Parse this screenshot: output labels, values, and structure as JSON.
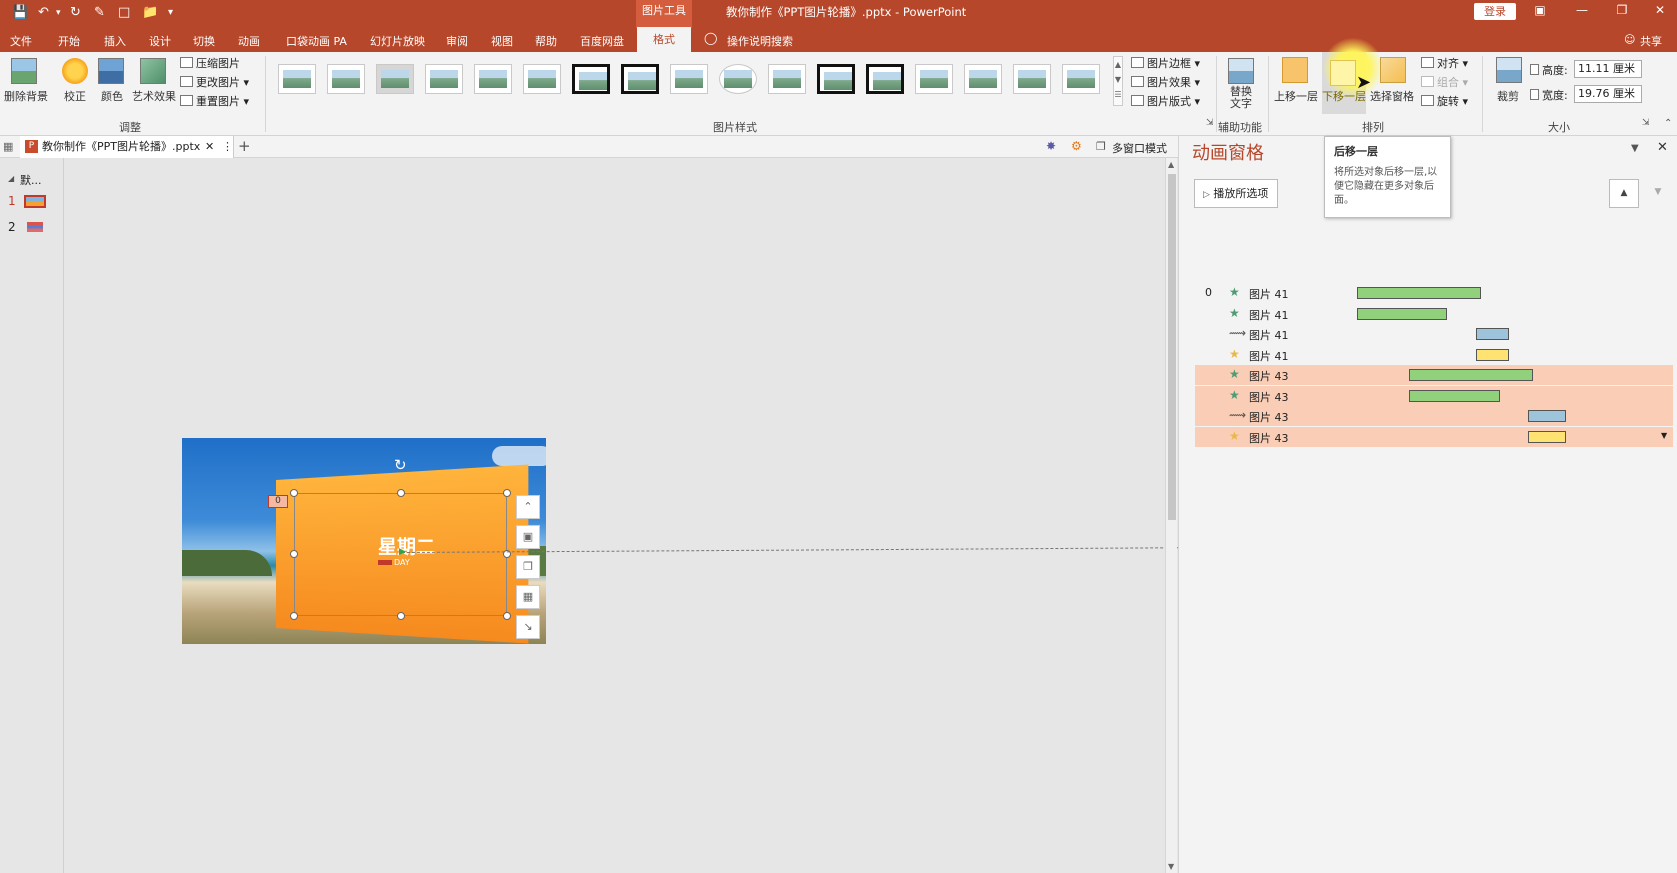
{
  "window": {
    "title": "教你制作《PPT图片轮播》.pptx  -  PowerPoint",
    "context_tab_group": "图片工具",
    "login": "登录",
    "share": "共享"
  },
  "menu_tabs": [
    "文件",
    "开始",
    "插入",
    "设计",
    "切换",
    "动画",
    "口袋动画 PA",
    "幻灯片放映",
    "审阅",
    "视图",
    "帮助",
    "百度网盘"
  ],
  "active_tab": "格式",
  "tell_me": "操作说明搜索",
  "ribbon": {
    "adjust": {
      "remove_bg": "删除背景",
      "correct": "校正",
      "color": "颜色",
      "art_effects": "艺术效果",
      "compress": "压缩图片",
      "change": "更改图片",
      "reset": "重置图片",
      "group_label": "调整"
    },
    "styles": {
      "group_label": "图片样式",
      "border": "图片边框",
      "effects": "图片效果",
      "layout": "图片版式"
    },
    "accessibility": {
      "alt_text": "替换\n文字",
      "group_label": "辅助功能"
    },
    "arrange": {
      "bring_forward": "上移一层",
      "send_backward": "下移一层",
      "selection_pane": "选择窗格",
      "align": "对齐",
      "group": "组合",
      "rotate": "旋转",
      "group_label": "排列"
    },
    "size": {
      "crop": "裁剪",
      "height_label": "高度:",
      "height_value": "11.11 厘米",
      "width_label": "宽度:",
      "width_value": "19.76 厘米",
      "group_label": "大小"
    }
  },
  "doc_tab": {
    "name": "教你制作《PPT图片轮播》.pptx",
    "multiwindow": "多窗口模式"
  },
  "thumbnails": {
    "section": "默...",
    "slides": [
      "1",
      "2"
    ]
  },
  "slide": {
    "title_text": "星期二",
    "sub_text": "DAY",
    "anim_marker": "0"
  },
  "tooltip": {
    "title": "后移一层",
    "body": "将所选对象后移一层,以便它隐藏在更多对象后面。"
  },
  "anim_pane": {
    "title": "动画窗格",
    "play_selected": "播放所选项",
    "items": [
      {
        "index": "0",
        "icon": "star-green",
        "name": "图片 41",
        "bar_color": "#92d17b",
        "start": 0.0,
        "end": 0.26,
        "selected": false
      },
      {
        "index": "",
        "icon": "star-green",
        "name": "图片 41",
        "bar_color": "#92d17b",
        "start": 0.0,
        "end": 0.19,
        "selected": false
      },
      {
        "index": "",
        "icon": "motion-path",
        "name": "图片 41",
        "bar_color": "#9ec4dc",
        "start": 0.25,
        "end": 0.32,
        "selected": false
      },
      {
        "index": "",
        "icon": "star-yellow",
        "name": "图片 41",
        "bar_color": "#ffe372",
        "start": 0.25,
        "end": 0.32,
        "selected": false
      },
      {
        "index": "",
        "icon": "star-green",
        "name": "图片 43",
        "bar_color": "#92d17b",
        "start": 0.11,
        "end": 0.37,
        "selected": true
      },
      {
        "index": "",
        "icon": "star-green",
        "name": "图片 43",
        "bar_color": "#92d17b",
        "start": 0.11,
        "end": 0.3,
        "selected": true
      },
      {
        "index": "",
        "icon": "motion-path",
        "name": "图片 43",
        "bar_color": "#9ec4dc",
        "start": 0.36,
        "end": 0.44,
        "selected": true
      },
      {
        "index": "",
        "icon": "star-yellow",
        "name": "图片 43",
        "bar_color": "#ffe372",
        "start": 0.36,
        "end": 0.44,
        "selected": true
      }
    ]
  },
  "colors": {
    "accent": "#b7472a",
    "selection": "#f9cdb6"
  }
}
